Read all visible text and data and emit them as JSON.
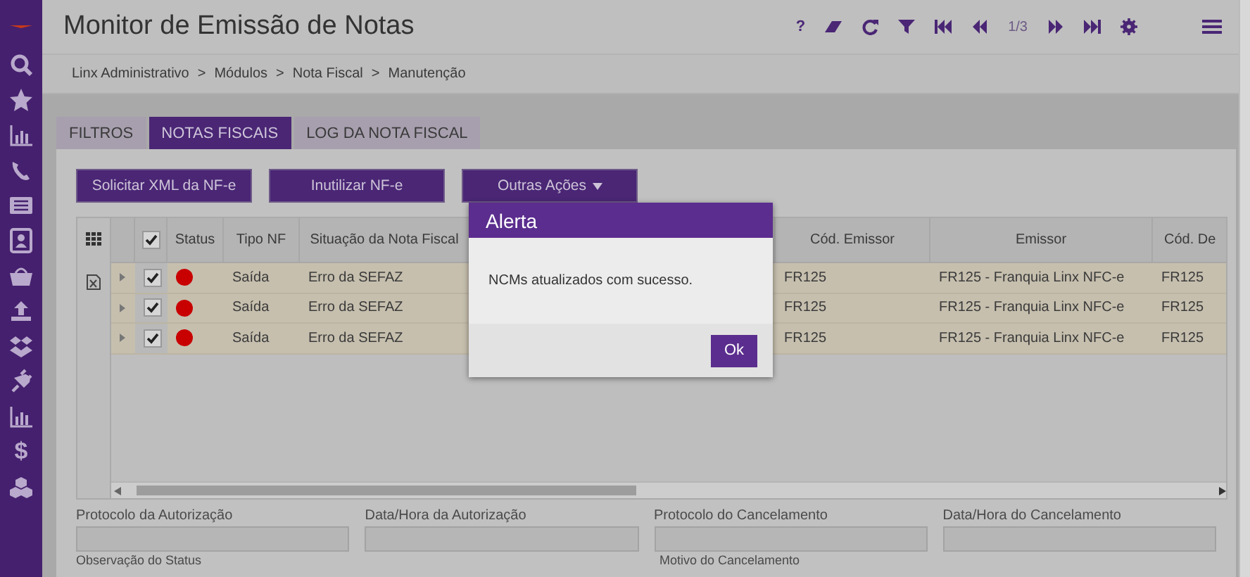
{
  "window": {
    "title": "Monitor de Emissão de Notas"
  },
  "toolbar": {
    "help": "?",
    "page": "1/3"
  },
  "breadcrumb": {
    "separator": ">",
    "items": [
      "Linx Administrativo",
      "Módulos",
      "Nota Fiscal",
      "Manutenção"
    ]
  },
  "sidebar": {
    "currency_symbol": "$"
  },
  "tabs": [
    {
      "label": "FILTROS",
      "selected": false
    },
    {
      "label": "NOTAS FISCAIS",
      "selected": true
    },
    {
      "label": "LOG DA NOTA FISCAL",
      "selected": false
    }
  ],
  "actions": [
    {
      "label": "Solicitar XML da NF-e",
      "kind": "button"
    },
    {
      "label": "Inutilizar NF-e",
      "kind": "button"
    },
    {
      "label": "Outras Ações",
      "kind": "dropdown"
    }
  ],
  "table": {
    "all_checked": true,
    "columns": [
      "Status",
      "Tipo NF",
      "Situação da Nota Fiscal",
      "Cód. Emissor",
      "Emissor",
      "Cód. De"
    ],
    "rows": [
      {
        "checked": true,
        "color": "#c80000",
        "cells": [
          "",
          "Saída",
          "Erro da SEFAZ",
          "FR125",
          "FR125 - Franquia Linx NFC-e",
          "FR125"
        ]
      },
      {
        "checked": true,
        "color": "#c80000",
        "cells": [
          "",
          "Saída",
          "Erro da SEFAZ",
          "FR125",
          "FR125 - Franquia Linx NFC-e",
          "FR125"
        ]
      },
      {
        "checked": true,
        "color": "#c80000",
        "cells": [
          "",
          "Saída",
          "Erro da SEFAZ",
          "FR125",
          "FR125 - Franquia Linx NFC-e",
          "FR125"
        ]
      }
    ]
  },
  "fields": [
    {
      "label": "Protocolo da Autorização"
    },
    {
      "label": "Data/Hora da Autorização"
    },
    {
      "label": "Protocolo do Cancelamento"
    },
    {
      "label": "Data/Hora do Cancelamento"
    }
  ],
  "more_fields": [
    {
      "label": "Observação do Status"
    },
    {
      "label": "Motivo do Cancelamento"
    }
  ],
  "alert": {
    "title": "Alerta",
    "message": "NCMs atualizados com sucesso.",
    "button": "Ok"
  }
}
